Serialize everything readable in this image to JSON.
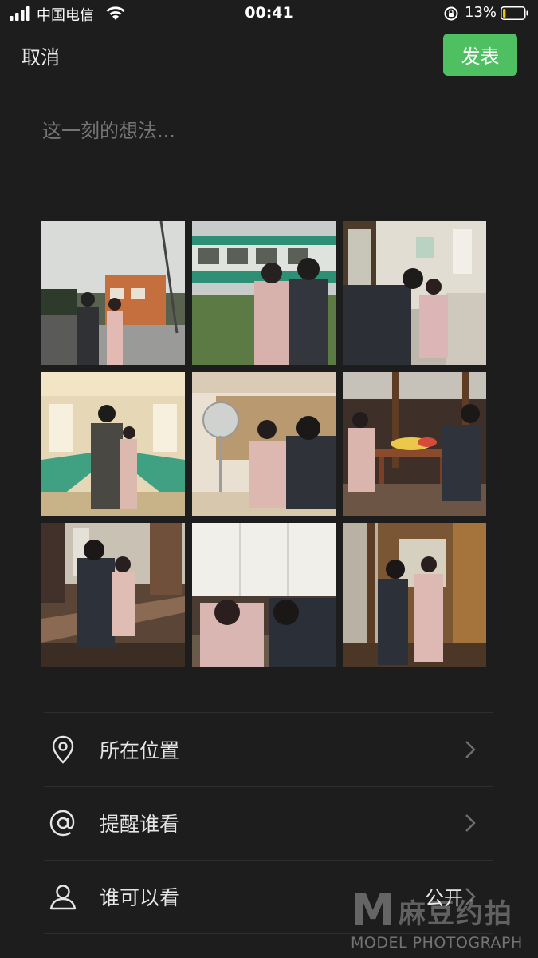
{
  "status_bar": {
    "carrier": "中国电信",
    "time": "00:41",
    "battery_percent": "13%",
    "battery_level": 0.13
  },
  "header": {
    "cancel_label": "取消",
    "post_label": "发表",
    "accent_color": "#4fc062"
  },
  "composer": {
    "placeholder": "这一刻的想法..."
  },
  "photos": [
    {
      "scene": "watchtower-couple"
    },
    {
      "scene": "train-platform-couple"
    },
    {
      "scene": "station-window-couple"
    },
    {
      "scene": "train-interior-couple"
    },
    {
      "scene": "fan-room-couple"
    },
    {
      "scene": "porch-watermelon-couple"
    },
    {
      "scene": "wooden-bench-couple"
    },
    {
      "scene": "curtain-peek-couple"
    },
    {
      "scene": "wooden-corridor-couple"
    }
  ],
  "options": [
    {
      "label": "所在位置",
      "icon": "location-pin-icon",
      "value": ""
    },
    {
      "label": "提醒谁看",
      "icon": "at-sign-icon",
      "value": ""
    },
    {
      "label": "谁可以看",
      "icon": "person-icon",
      "value": "公开"
    }
  ],
  "watermark": {
    "letter": "M",
    "brand": "麻豆约拍",
    "subtitle": "MODEL PHOTOGRAPH"
  }
}
